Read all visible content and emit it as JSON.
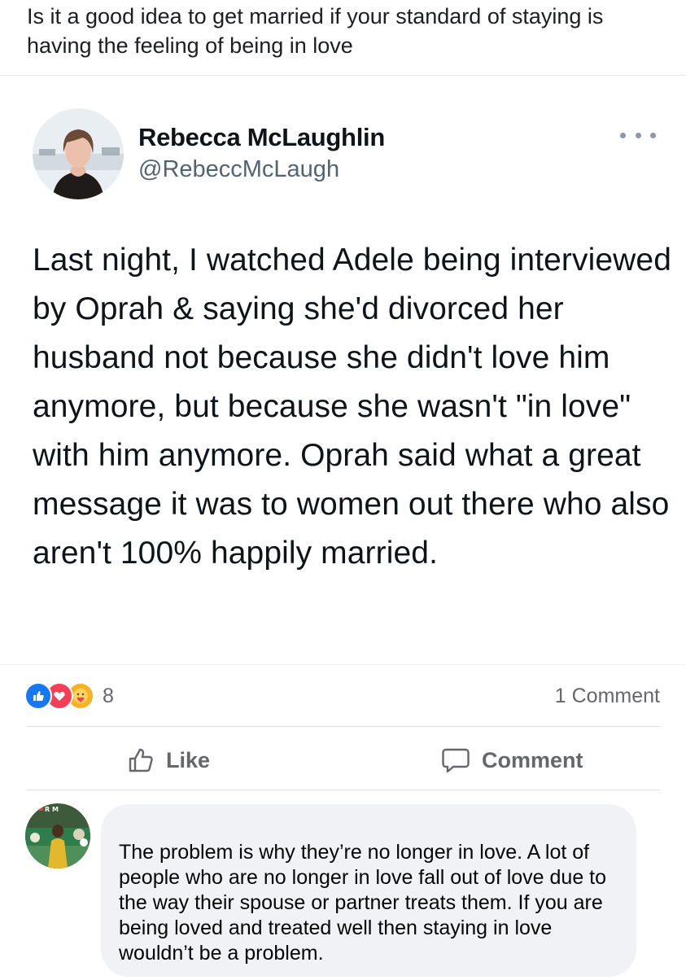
{
  "post": {
    "caption": "Is it a good idea to get married if your standard of staying is having the feeling of being in love"
  },
  "tweet": {
    "author_name": "Rebecca McLaughlin",
    "author_handle": "@RebeccMcLaugh",
    "text": "Last night, I watched Adele being interviewed by Oprah & saying she'd divorced her husband not because she didn't love him anymore, but because she wasn't \"in love\" with him anymore. Oprah said what a great message it was to women out there who also aren't 100% happily married."
  },
  "reactions": {
    "icons": [
      "like-icon",
      "love-icon",
      "care-icon"
    ],
    "count": "8",
    "comment_count": "1 Comment"
  },
  "actions": {
    "like_label": "Like",
    "comment_label": "Comment"
  },
  "comment": {
    "avatar_initials": "R M",
    "text": "The problem is why they’re no longer in love. A lot of people who are no longer in love fall out of love due to the way their spouse or partner treats them. If you are being loved and treated well then staying in love wouldn’t be a problem."
  },
  "colors": {
    "facebook_blue": "#1877f2",
    "love_red": "#f33e58",
    "care_yellow": "#f7b125",
    "secondary_text": "#65676b",
    "bubble_bg": "#f0f2f5"
  }
}
